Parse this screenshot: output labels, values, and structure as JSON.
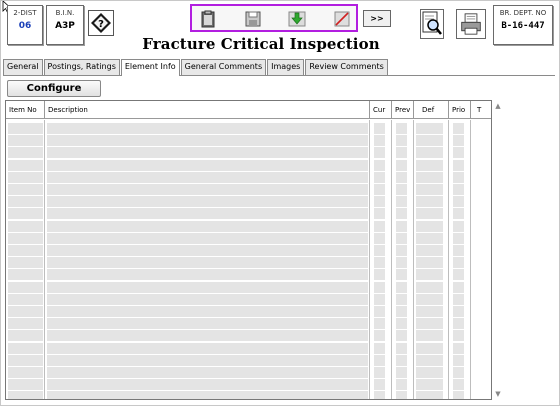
{
  "header": {
    "dist_label": "2-DIST",
    "dist_value": "06",
    "bin_label": "B.I.N.",
    "bin_value": "A3P",
    "dept_label": "BR. DEPT. NO",
    "dept_value": "B-16-447",
    "title": "Fracture Critical Inspection",
    "more_label": ">>"
  },
  "toolbar": {
    "icons": [
      "clipboard-icon",
      "save-icon",
      "download-arrow-icon",
      "delete-icon"
    ],
    "highlight_color": "#b21ee0"
  },
  "tabs": [
    {
      "label": "General"
    },
    {
      "label": "Postings, Ratings"
    },
    {
      "label": "Element Info"
    },
    {
      "label": "General Comments"
    },
    {
      "label": "Images"
    },
    {
      "label": "Review Comments"
    }
  ],
  "active_tab": "Element Info",
  "configure_label": "Configure",
  "grid": {
    "columns": [
      {
        "key": "item_no",
        "label": "Item No"
      },
      {
        "key": "description",
        "label": "Description"
      },
      {
        "key": "cur",
        "label": "Cur"
      },
      {
        "key": "prev",
        "label": "Prev"
      },
      {
        "key": "def",
        "label": "Def"
      },
      {
        "key": "prio",
        "label": "Prio"
      },
      {
        "key": "t",
        "label": "T"
      }
    ],
    "row_count": 23
  },
  "scrollbar": {
    "up": "▲",
    "down": "▼"
  },
  "colors": {
    "dist_value": "#1a3fb8",
    "cell_fill": "#e4e4e4"
  }
}
